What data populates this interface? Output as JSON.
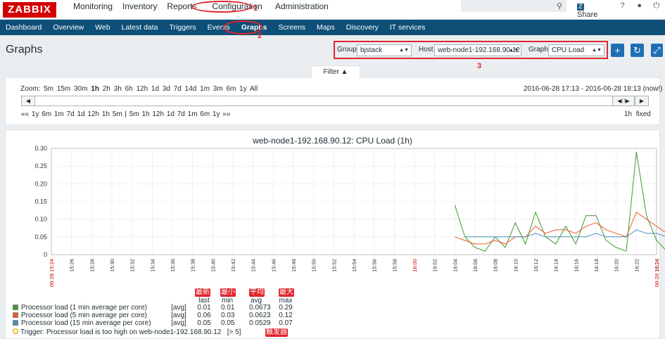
{
  "brand": "ZABBIX",
  "main_menu": [
    "Monitoring",
    "Inventory",
    "Reports",
    "Configuration",
    "Administration"
  ],
  "top_links": {
    "share": "Share",
    "help": "?",
    "user": "user-icon",
    "logout": "power-icon"
  },
  "sub_menu": [
    "Dashboard",
    "Overview",
    "Web",
    "Latest data",
    "Triggers",
    "Events",
    "Graphs",
    "Screens",
    "Maps",
    "Discovery",
    "IT services"
  ],
  "annotations": [
    "1",
    "2",
    "3"
  ],
  "page_title": "Graphs",
  "filters": {
    "group_label": "Group",
    "group_value": "bjstack",
    "host_label": "Host",
    "host_value": "web-node1-192.168.90.12",
    "graph_label": "Graph",
    "graph_value": "CPU Load"
  },
  "filter_tab": "Filter ▲",
  "zoom": {
    "label": "Zoom:",
    "options": [
      "5m",
      "15m",
      "30m",
      "1h",
      "2h",
      "3h",
      "6h",
      "12h",
      "1d",
      "3d",
      "7d",
      "14d",
      "1m",
      "3m",
      "6m",
      "1y",
      "All"
    ],
    "period": "2016-06-28 17:13 - 2016-06-28 18:13 (now!)",
    "steps_left": "«« 1y 6m 1m 7d 1d 12h 1h 5m | 5m 1h 12h 1d 7d 1m 6m 1y »»",
    "duration": "1h",
    "fixed": "fixed"
  },
  "legend_heads": {
    "last": "last",
    "min": "min",
    "avg": "avg",
    "max": "max",
    "zh_last": "最新",
    "zh_min": "最小",
    "zh_avg": "平均",
    "zh_max": "最大",
    "zh_trigger": "触发器"
  },
  "legend": [
    {
      "name": "Processor load (1 min average per core)",
      "fn": "[avg]",
      "last": "0.01",
      "min": "0.01",
      "avg": "0.0673",
      "max": "0.29",
      "color": "#3c9a2d"
    },
    {
      "name": "Processor load (5 min average per core)",
      "fn": "[avg]",
      "last": "0.06",
      "min": "0.03",
      "avg": "0.0623",
      "max": "0.12",
      "color": "#ef5a2c"
    },
    {
      "name": "Processor load (15 min average per core)",
      "fn": "[avg]",
      "last": "0.05",
      "min": "0.05",
      "avg": "0.0529",
      "max": "0.07",
      "color": "#4a8db7"
    }
  ],
  "trigger": {
    "text": "Trigger: Processor load is too high on web-node1-192.168.90.12",
    "cond": "[> 5]"
  },
  "chart_data": {
    "type": "line",
    "title": "web-node1-192.168.90.12: CPU Load (1h)",
    "ylim": [
      0,
      0.3
    ],
    "yticks": [
      "0",
      "0.05",
      "0.10",
      "0.15",
      "0.20",
      "0.25",
      "0.30"
    ],
    "xticks": [
      "15:26",
      "15:28",
      "15:30",
      "15:32",
      "15:34",
      "15:36",
      "15:38",
      "15:40",
      "15:42",
      "15:44",
      "15:46",
      "15:48",
      "15:50",
      "15:52",
      "15:54",
      "15:56",
      "15:58",
      "16:00",
      "16:02",
      "16:04",
      "16:06",
      "16:08",
      "16:10",
      "16:12",
      "16:14",
      "16:16",
      "16:18",
      "16:20",
      "16:22",
      "16:24"
    ],
    "xstart_label": "06-28 15:24",
    "xend_label": "06-28 16:24",
    "x": [
      "16:04",
      "16:05",
      "16:06",
      "16:07",
      "16:08",
      "16:09",
      "16:10",
      "16:11",
      "16:12",
      "16:13",
      "16:14",
      "16:15",
      "16:16",
      "16:17",
      "16:18",
      "16:19",
      "16:20",
      "16:21",
      "16:22",
      "16:23",
      "16:24",
      "16:25"
    ],
    "series": [
      {
        "name": "Processor load (1 min average per core)",
        "color": "#3c9a2d",
        "values": [
          0.14,
          0.05,
          0.02,
          0.01,
          0.05,
          0.02,
          0.09,
          0.03,
          0.12,
          0.05,
          0.03,
          0.08,
          0.03,
          0.11,
          0.11,
          0.04,
          0.02,
          0.01,
          0.29,
          0.11,
          0.04,
          0.01
        ]
      },
      {
        "name": "Processor load (5 min average per core)",
        "color": "#ef5a2c",
        "values": [
          0.05,
          0.04,
          0.03,
          0.03,
          0.04,
          0.03,
          0.05,
          0.05,
          0.08,
          0.06,
          0.07,
          0.07,
          0.06,
          0.08,
          0.09,
          0.07,
          0.06,
          0.05,
          0.12,
          0.1,
          0.08,
          0.06
        ]
      },
      {
        "name": "Processor load (15 min average per core)",
        "color": "#4a8db7",
        "values": [
          null,
          0.05,
          0.05,
          0.05,
          0.05,
          0.05,
          0.05,
          0.05,
          0.06,
          0.05,
          0.05,
          0.05,
          0.05,
          0.05,
          0.06,
          0.05,
          0.05,
          0.05,
          0.07,
          0.06,
          0.06,
          0.05
        ]
      }
    ]
  }
}
